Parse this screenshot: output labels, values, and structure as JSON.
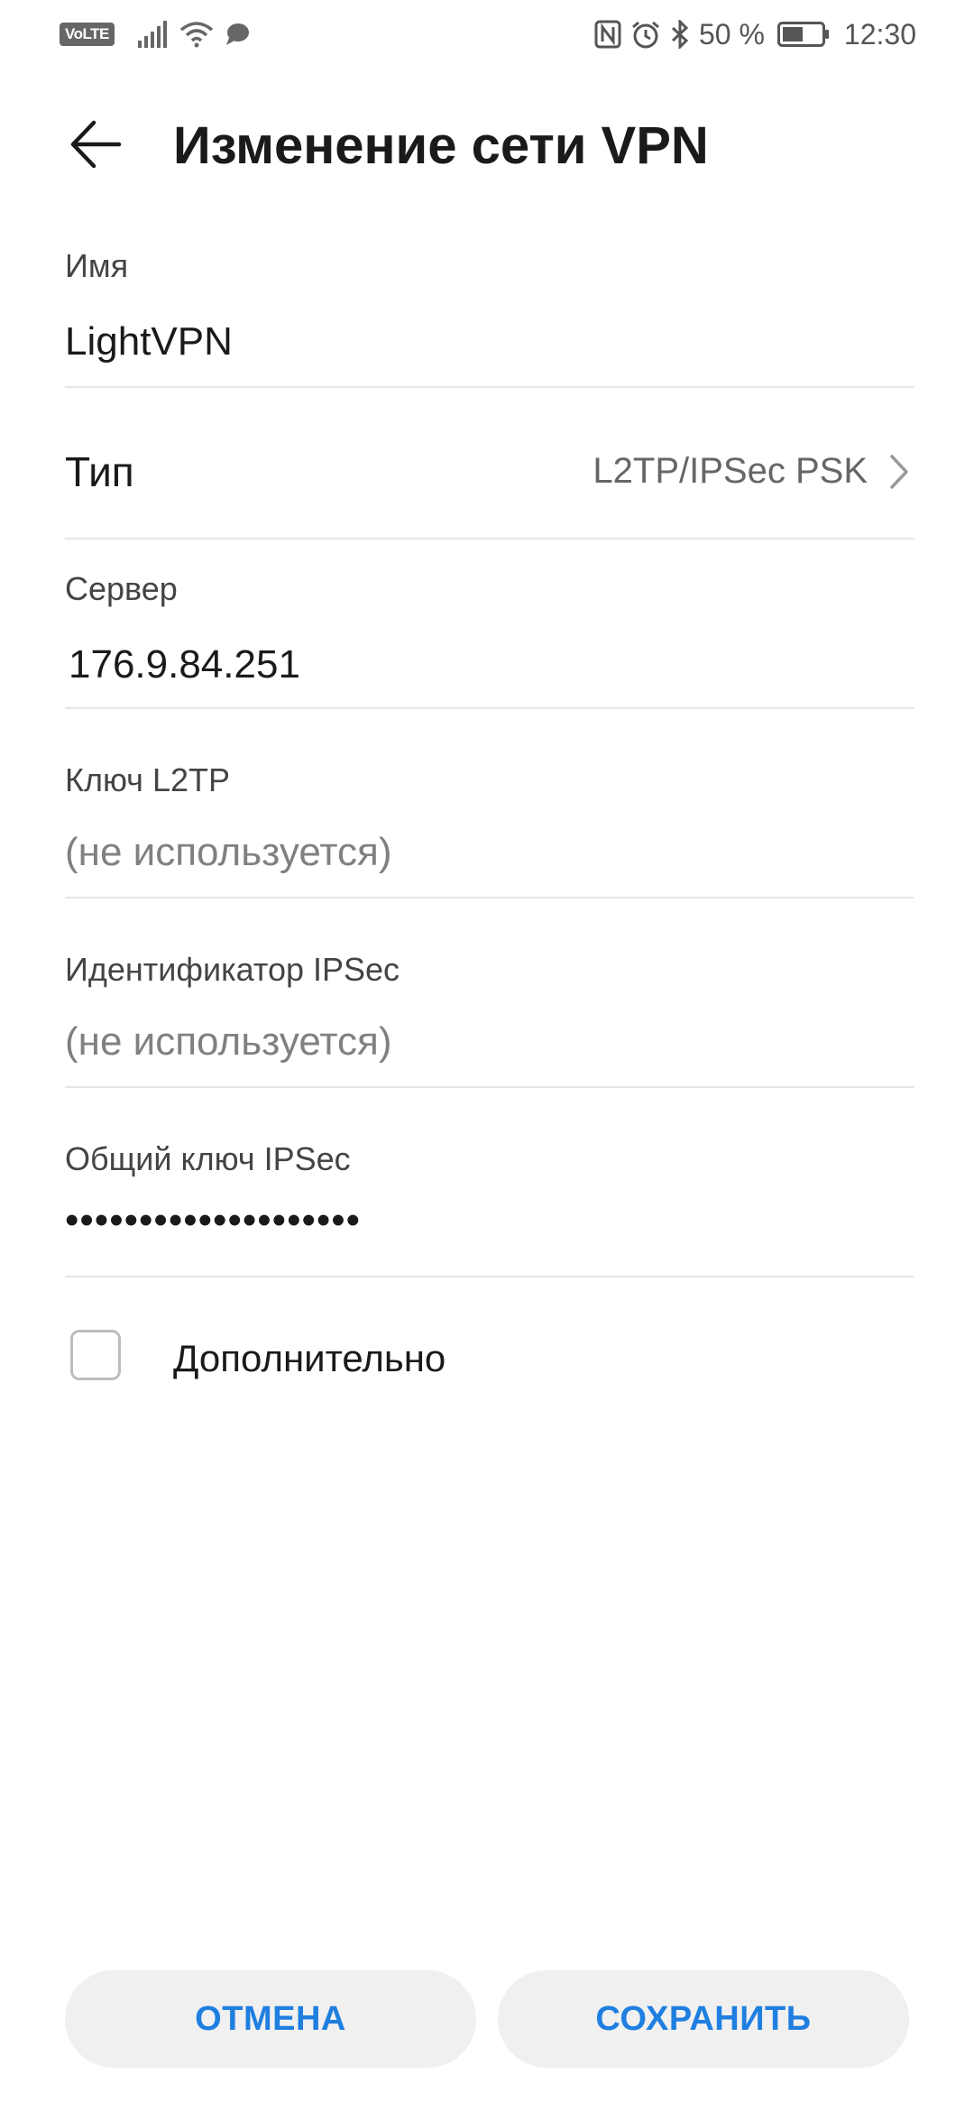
{
  "status_bar": {
    "volte_label": "VoLTE",
    "battery_percent": "50 %",
    "time": "12:30",
    "icons": [
      "signal-icon",
      "wifi-icon",
      "message-icon",
      "nfc-icon",
      "alarm-icon",
      "bluetooth-icon",
      "battery-icon"
    ]
  },
  "header": {
    "title": "Изменение сети VPN",
    "back_icon": "arrow-left-icon"
  },
  "form": {
    "name": {
      "label": "Имя",
      "value": "LightVPN"
    },
    "type": {
      "label": "Тип",
      "value": "L2TP/IPSec PSK"
    },
    "server": {
      "label": "Сервер",
      "value": "176.9.84.251"
    },
    "l2tp_key": {
      "label": "Ключ L2TP",
      "placeholder": "(не используется)"
    },
    "ipsec_id": {
      "label": "Идентификатор IPSec",
      "placeholder": "(не используется)"
    },
    "ipsec_psk": {
      "label": "Общий ключ IPSec",
      "value": "••••••••••••••••••••"
    },
    "advanced": {
      "label": "Дополнительно",
      "checked": false
    }
  },
  "buttons": {
    "cancel": "ОТМЕНА",
    "save": "СОХРАНИТЬ"
  },
  "colors": {
    "accent": "#1f7fe0",
    "divider": "#e6e6e6",
    "button_bg": "#f0f0f0"
  }
}
